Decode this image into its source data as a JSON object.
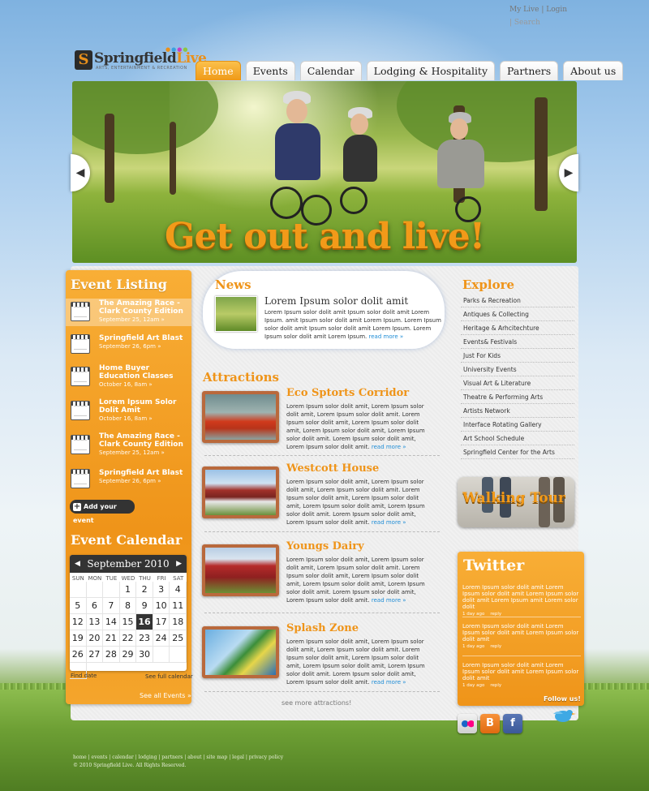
{
  "top": {
    "my_live": "My Live",
    "sep": "|",
    "login": "Login",
    "search": "| Search"
  },
  "logo": {
    "mark": "S",
    "name_a": "Springfield",
    "name_b": "Live",
    "tagline": "ARTS, ENTERTAINMENT & RECREATION"
  },
  "nav": [
    "Home",
    "Events",
    "Calendar",
    "Lodging & Hospitality",
    "Partners",
    "About us"
  ],
  "hero": {
    "slogan": "Get out and live!"
  },
  "event_listing": {
    "title": "Event Listing",
    "events": [
      {
        "title": "The Amazing Race - Clark County Edition",
        "date": "September 25, 12am »"
      },
      {
        "title": "Springfield Art Blast",
        "date": "September 26, 6pm »"
      },
      {
        "title": "Home Buyer Education Classes",
        "date": "October 16, 8am »"
      },
      {
        "title": "Lorem Ipsum Solor Dolit Amit",
        "date": "October 16, 8am »"
      },
      {
        "title": "The Amazing Race - Clark County Edition",
        "date": "September 25, 12am »"
      },
      {
        "title": "Springfield Art Blast",
        "date": "September 26, 6pm »"
      }
    ],
    "add_button": "Add your event"
  },
  "calendar": {
    "title": "Event Calendar",
    "month": "September 2010",
    "prev": "◀",
    "next": "▶",
    "days_of_week": [
      "SUN",
      "MON",
      "TUE",
      "WED",
      "THU",
      "FRI",
      "SAT"
    ],
    "cells": [
      "",
      "",
      "",
      "1",
      "2",
      "3",
      "4",
      "5",
      "6",
      "7",
      "8",
      "9",
      "10",
      "11",
      "12",
      "13",
      "14",
      "15",
      "16",
      "17",
      "18",
      "19",
      "20",
      "21",
      "22",
      "23",
      "24",
      "25",
      "26",
      "27",
      "28",
      "29",
      "30",
      "",
      "",
      ""
    ],
    "today": "16",
    "find_date": "Find date",
    "see_full": "See full calendar",
    "see_all": "See all Events »"
  },
  "news": {
    "title": "News",
    "headline": "Lorem Ipsum solor dolit amit",
    "body": "Lorem Ipsum solor dolit amit Ipsum solor dolit amit  Lorem Ipsum. amit Ipsum solor dolit amit  Lorem Ipsum.  Lorem Ipsum solor dolit amit Ipsum solor dolit amit  Lorem Ipsum.  Lorem Ipsum solor dolit amit Lorem Ipsum.",
    "more": "read more »"
  },
  "attractions": {
    "title": "Attractions",
    "items": [
      {
        "name": "Eco Sptorts Corridor",
        "body": "Lorem Ipsum solor dolit amit, Lorem Ipsum solor dolit amit, Lorem Ipsum solor dolit amit. Lorem Ipsum solor dolit amit, Lorem Ipsum solor dolit amit, Lorem Ipsum solor dolit amit, Lorem Ipsum solor dolit amit. Lorem Ipsum solor dolit amit, Lorem Ipsum solor dolit amit.",
        "more": "read more »"
      },
      {
        "name": "Westcott House",
        "body": "Lorem Ipsum solor dolit amit, Lorem Ipsum solor dolit amit, Lorem Ipsum solor dolit amit. Lorem Ipsum solor dolit amit, Lorem Ipsum solor dolit amit, Lorem Ipsum solor dolit amit, Lorem Ipsum solor dolit amit. Lorem Ipsum solor dolit amit, Lorem Ipsum solor dolit amit.",
        "more": "read more »"
      },
      {
        "name": "Youngs Dairy",
        "body": "Lorem Ipsum solor dolit amit, Lorem Ipsum solor dolit amit, Lorem Ipsum solor dolit amit. Lorem Ipsum solor dolit amit, Lorem Ipsum solor dolit amit, Lorem Ipsum solor dolit amit, Lorem Ipsum solor dolit amit. Lorem Ipsum solor dolit amit, Lorem Ipsum solor dolit amit.",
        "more": "read more »"
      },
      {
        "name": "Splash Zone",
        "body": "Lorem Ipsum solor dolit amit, Lorem Ipsum solor dolit amit, Lorem Ipsum solor dolit amit. Lorem Ipsum solor dolit amit, Lorem Ipsum solor dolit amit, Lorem Ipsum solor dolit amit, Lorem Ipsum solor dolit amit. Lorem Ipsum solor dolit amit, Lorem Ipsum solor dolit amit.",
        "more": "read more »"
      }
    ],
    "see_more": "see more attractions!"
  },
  "explore": {
    "title": "Explore",
    "items": [
      "Parks & Recreation",
      "Antiques & Collecting",
      "Heritage & Arhcitechture",
      "Events& Festivals",
      "Just For Kids",
      "University Events",
      "Visual Art & Literature",
      "Theatre & Performing Arts",
      "Artists Network",
      "Interface Rotating Gallery",
      "Art School Schedule",
      "Springfield Center for the Arts"
    ]
  },
  "walking_tour": "Walking Tour",
  "twitter": {
    "title": "Twitter",
    "tweets": [
      {
        "text": "Lorem Ipsum solor dolit amit Lorem Ipsum solor dolit amit Lorem Ipsum solor dolit amit Lorem Ipsum amit Lorem solor dolit",
        "time": "1 day ago",
        "reply": "reply"
      },
      {
        "text": "Lorem Ipsum solor dolit amit Lorem Ipsum solor dolit amit Lorem Ipsum solor dolit amit",
        "time": "1 day ago",
        "reply": "reply"
      },
      {
        "text": "Lorem Ipsum solor dolit amit Lorem Ipsum solor dolit amit Lorem Ipsum solor dolit amit",
        "time": "1 day ago",
        "reply": "reply"
      }
    ],
    "follow": "Follow us!"
  },
  "social": {
    "flickr": "●●",
    "blogger": "B",
    "facebook": "f"
  },
  "footer": {
    "links": "home | events | calendar | lodging | partners | about | site map | legal | privacy policy",
    "copyright": "© 2010 Springfield Live. All Rights Reserved."
  },
  "colors": {
    "accent": "#ef9419",
    "link": "#1f8dd6",
    "dark": "#333333"
  }
}
